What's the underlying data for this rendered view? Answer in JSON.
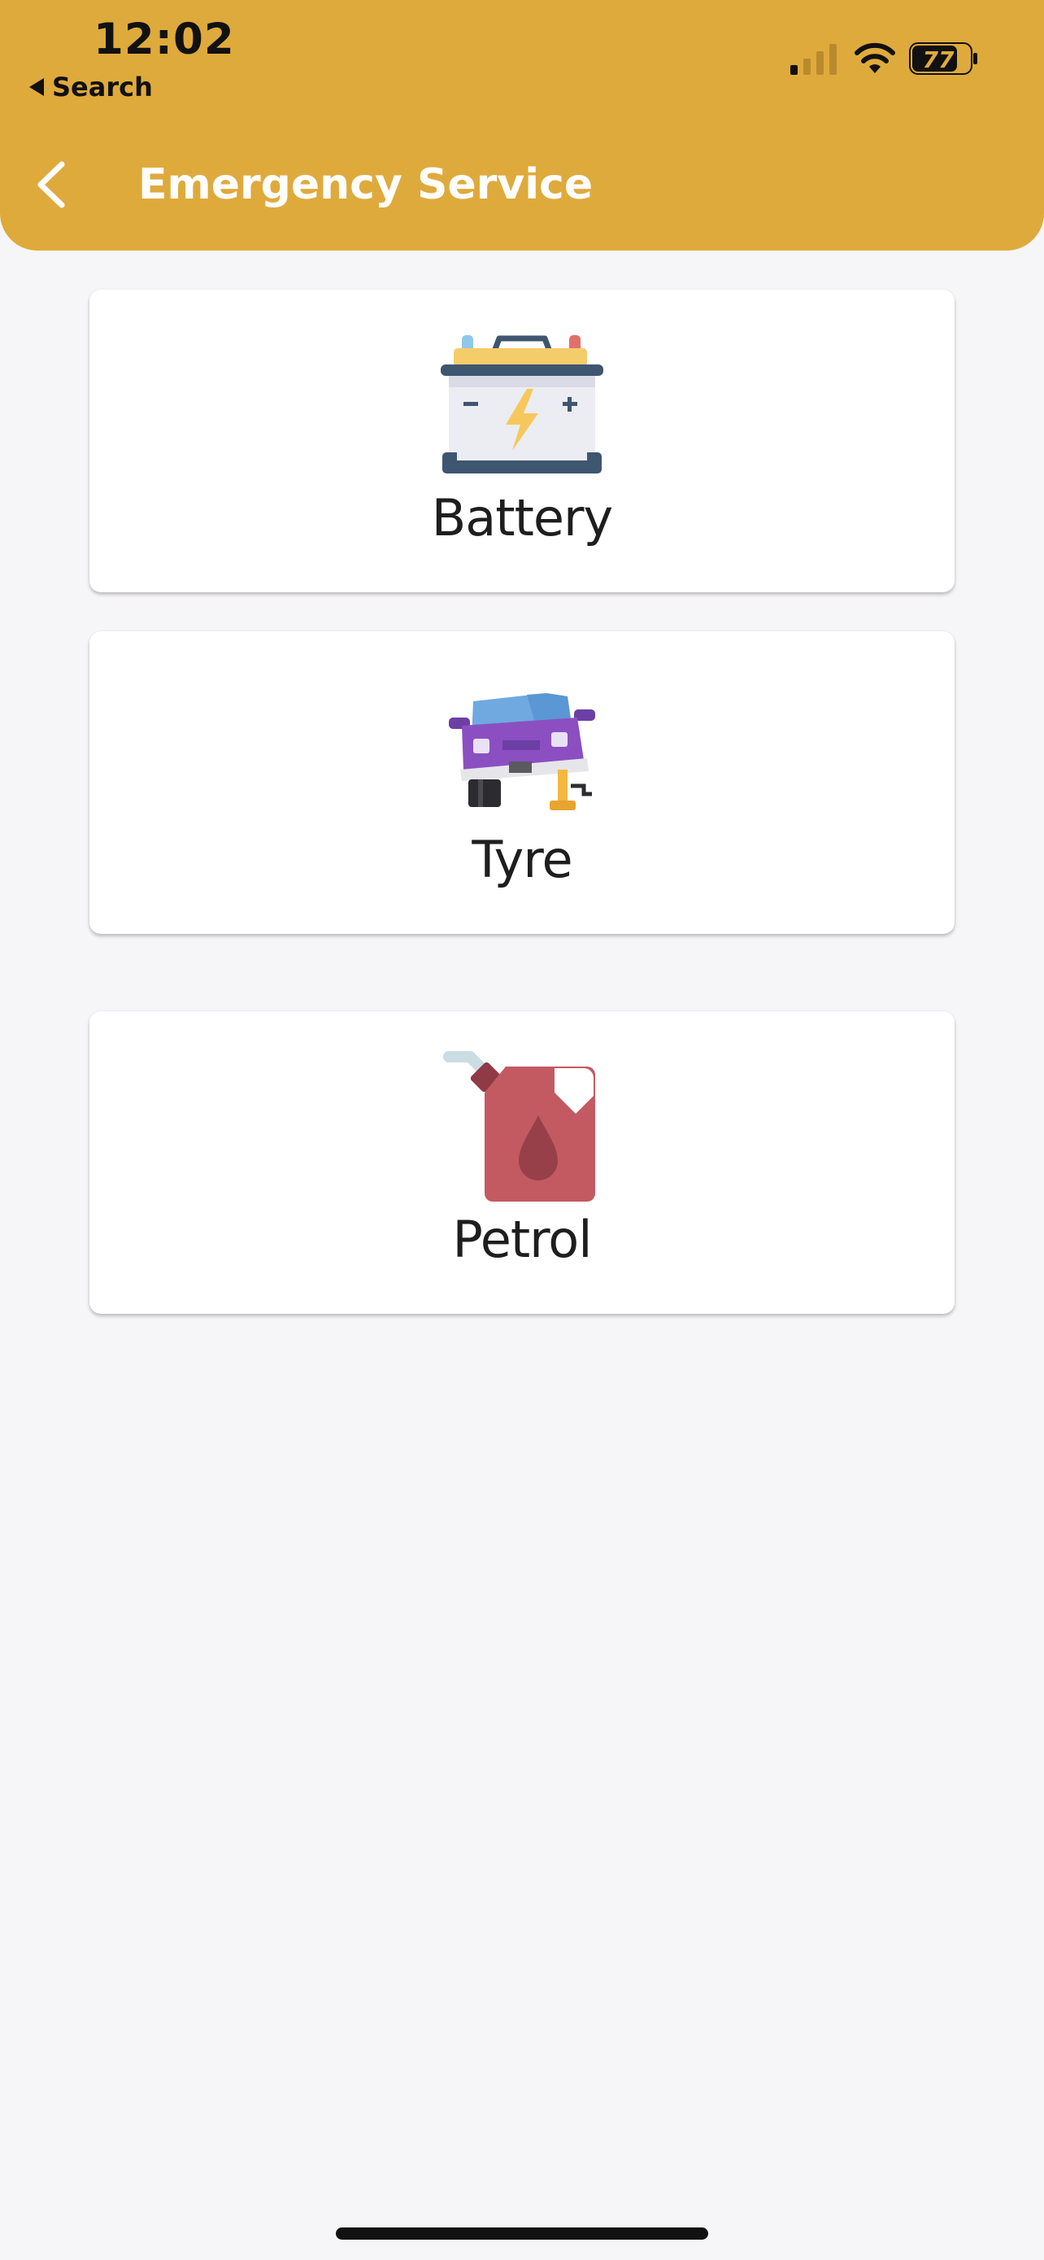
{
  "status_bar": {
    "time": "12:02",
    "back_app": "Search",
    "battery_percent": "77"
  },
  "header": {
    "title": "Emergency Service",
    "back_icon": "chevron-left-icon",
    "color": "#dfaa3c"
  },
  "services": [
    {
      "label": "Battery",
      "icon": "car-battery-icon"
    },
    {
      "label": "Tyre",
      "icon": "car-jack-icon"
    },
    {
      "label": "Petrol",
      "icon": "fuel-can-icon"
    }
  ]
}
